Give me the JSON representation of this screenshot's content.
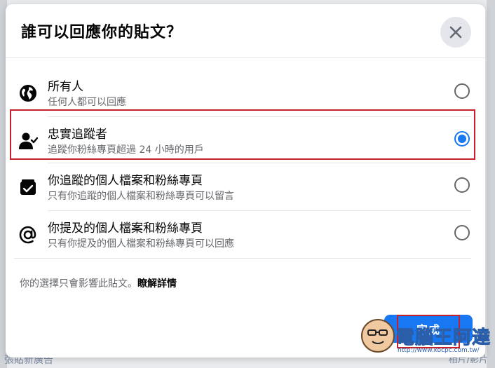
{
  "dialog": {
    "title": "誰可以回應你的貼文？",
    "close_icon": "close-icon"
  },
  "options": [
    {
      "label": "所有人",
      "description": "任何人都可以回應",
      "icon": "globe-icon",
      "selected": false
    },
    {
      "label": "忠實追蹤者",
      "description": "追蹤你粉絲專頁超過 24 小時的用戶",
      "icon": "follower-check-icon",
      "selected": true
    },
    {
      "label": "你追蹤的個人檔案和粉絲專頁",
      "description": "只有你追蹤的個人檔案和粉絲專頁可以留言",
      "icon": "checkbox-folder-icon",
      "selected": false
    },
    {
      "label": "你提及的個人檔案和粉絲專頁",
      "description": "只有你提及的個人檔案和粉絲專頁可以回應",
      "icon": "at-sign-icon",
      "selected": false
    }
  ],
  "footer": {
    "note": "你的選擇只會影響此貼文。",
    "link": "瞭解詳情"
  },
  "done_button": {
    "label": "完成"
  },
  "background": {
    "bottom_left_text": "張貼新廣告",
    "bottom_right_text": "相片/影片"
  },
  "watermark": {
    "text": "電腦王阿達",
    "url": "http://www.kocpc.com.tw/"
  },
  "colors": {
    "accent": "#1877f2",
    "highlight": "#c8202a"
  }
}
